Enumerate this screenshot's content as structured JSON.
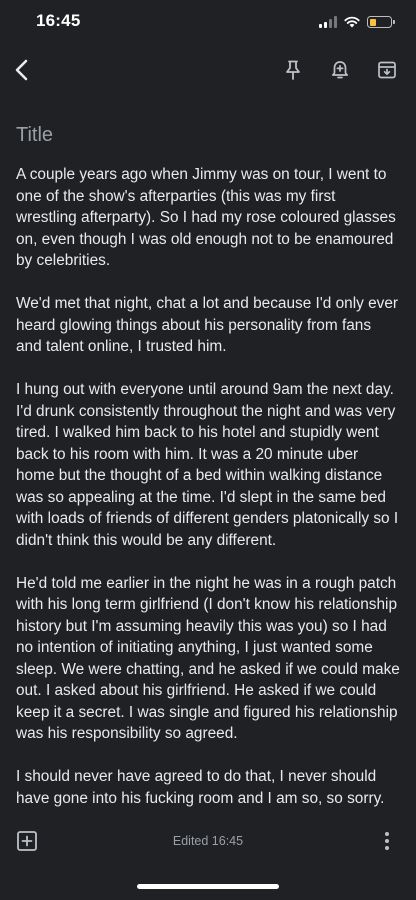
{
  "status": {
    "time": "16:45",
    "battery_color": "#f6c443"
  },
  "toolbar": {
    "back_icon": "chevron-left-icon",
    "pin_icon": "pin-icon",
    "reminder_icon": "bell-plus-icon",
    "archive_icon": "archive-icon"
  },
  "note": {
    "title_placeholder": "Title",
    "paragraphs": [
      "A couple years ago when Jimmy was on tour, I went to one of the show's afterparties (this was my first wrestling afterparty). So I had my rose coloured glasses on, even though I was old enough not to be enamoured by celebrities.",
      "We'd met that night, chat a lot and because I'd only ever heard glowing things about his personality from fans and talent online, I trusted him.",
      "I hung out with everyone until around 9am the next day. I'd drunk consistently throughout the night and was very tired. I walked him back to his hotel and stupidly went back to his room with him. It was a 20 minute uber home but the thought of a bed within walking distance was so appealing at the time. I'd slept in the same bed with loads of friends of different genders platonically so I didn't think this would be any different.",
      "He'd told me earlier in the night he was in a rough patch with his long term girlfriend (I don't know his relationship history but I'm assuming heavily this was you) so I had no intention of initiating anything, I just wanted some sleep. We were chatting, and he asked if we could make out. I asked about his girlfriend. He asked if we could keep it a secret. I was single and figured his relationship was his responsibility so agreed.",
      "I should never have agreed to do that, I never should have gone into his fucking room and I am so, so sorry."
    ]
  },
  "bottom": {
    "edited_label": "Edited 16:45",
    "add_icon": "add-box-icon",
    "more_icon": "more-vertical-icon"
  }
}
